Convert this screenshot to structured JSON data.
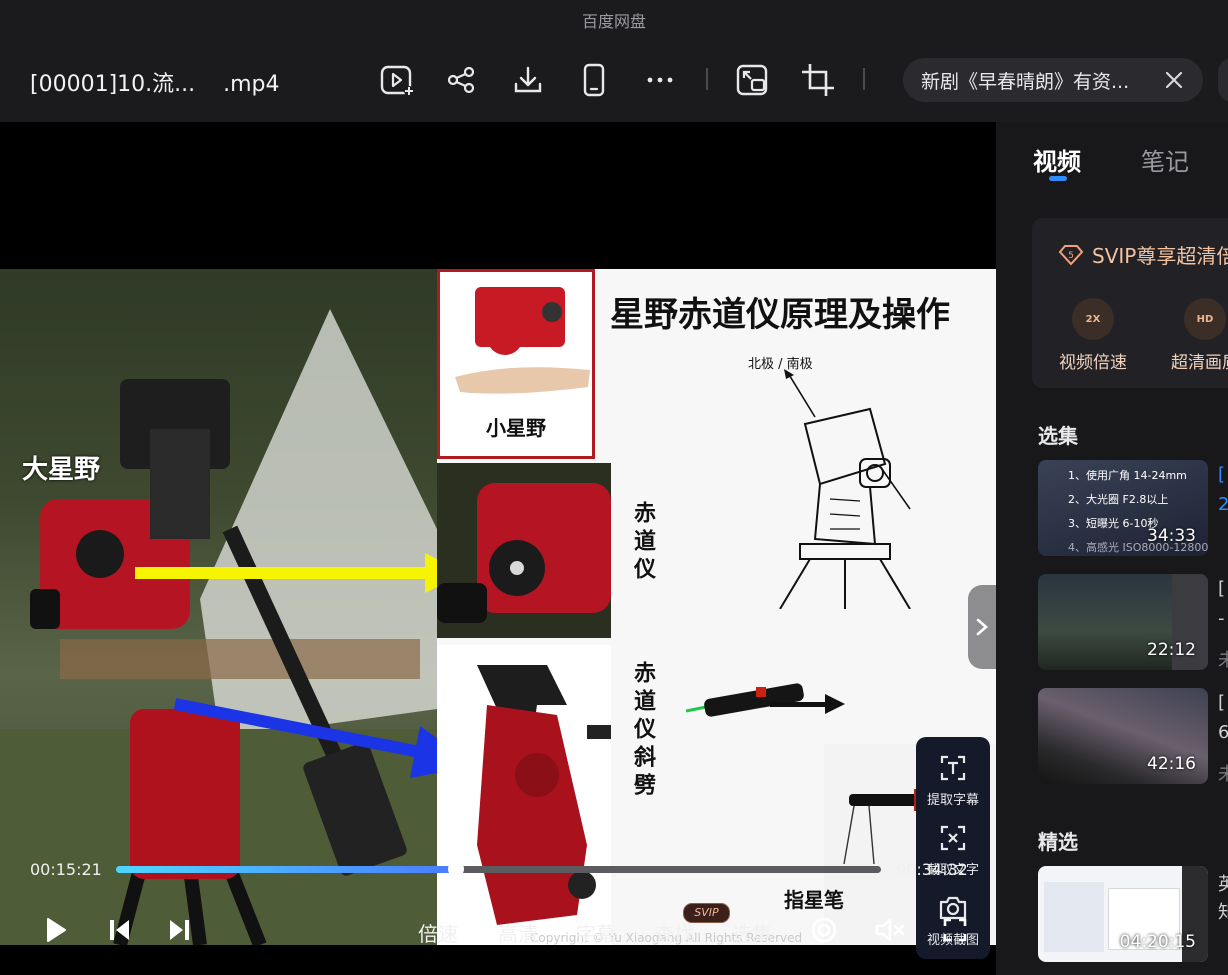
{
  "window": {
    "app_name": "百度网盘",
    "file_title": "[00001]10.流...    .mp4"
  },
  "toolbar": {
    "icons": [
      "video-add-icon",
      "share-icon",
      "download-icon",
      "phone-icon",
      "more-icon",
      "screen-switch-icon",
      "crop-icon"
    ]
  },
  "notice": {
    "text": "新剧《早春晴朗》有资..."
  },
  "slide": {
    "title": "星野赤道仪原理及操作",
    "label_big": "大星野",
    "label_small": "小星野",
    "label_pole": "北极 / 南极",
    "label_equatorial": "赤道仪",
    "label_wedge": "赤道仪斜劈",
    "label_laser": "指星笔",
    "copyright": "Copyright © Yu Xiaogang All Rights Reserved"
  },
  "tools": {
    "extract_subtitle": "提取字幕",
    "capture_text": "截取文字",
    "screenshot": "视频截图"
  },
  "playback": {
    "current_time": "00:15:21",
    "total_time": "00:34:32",
    "progress": 0.4444
  },
  "controls": {
    "speed": "倍速",
    "quality": "高清",
    "subtitle": "字幕",
    "search": "查找",
    "search_badge": "SVIP",
    "episodes": "选集"
  },
  "sidebar": {
    "tab_video": "视频",
    "tab_notes": "笔记",
    "svip_title": "SVIP尊享超清倍",
    "feature_speed": "视频倍速",
    "feature_speed_icon": "2X",
    "feature_hd": "超清画质",
    "feature_hd_icon": "HD",
    "section_episodes": "选集",
    "section_featured": "精选",
    "episodes": [
      {
        "duration": "34:33",
        "overlay": [
          "1、使用广角 14-24mm",
          "2、大光圈 F2.8以上",
          "3、短曝光 6-10秒",
          "4、高感光 ISO8000-12800"
        ],
        "side": "[",
        "side2": "2"
      },
      {
        "duration": "22:12",
        "side": "[",
        "side2": "-",
        "side3": "未"
      },
      {
        "duration": "42:16",
        "side": "[",
        "side2": "6",
        "side3": "未"
      }
    ],
    "featured": [
      {
        "duration": "04:20:15",
        "side": "英",
        "side2": "知"
      }
    ]
  },
  "colors": {
    "accent": "#2f8cff",
    "svip": "#f2c3a2",
    "progress_start": "#4fd6ff",
    "progress_end": "#4a7cff"
  }
}
